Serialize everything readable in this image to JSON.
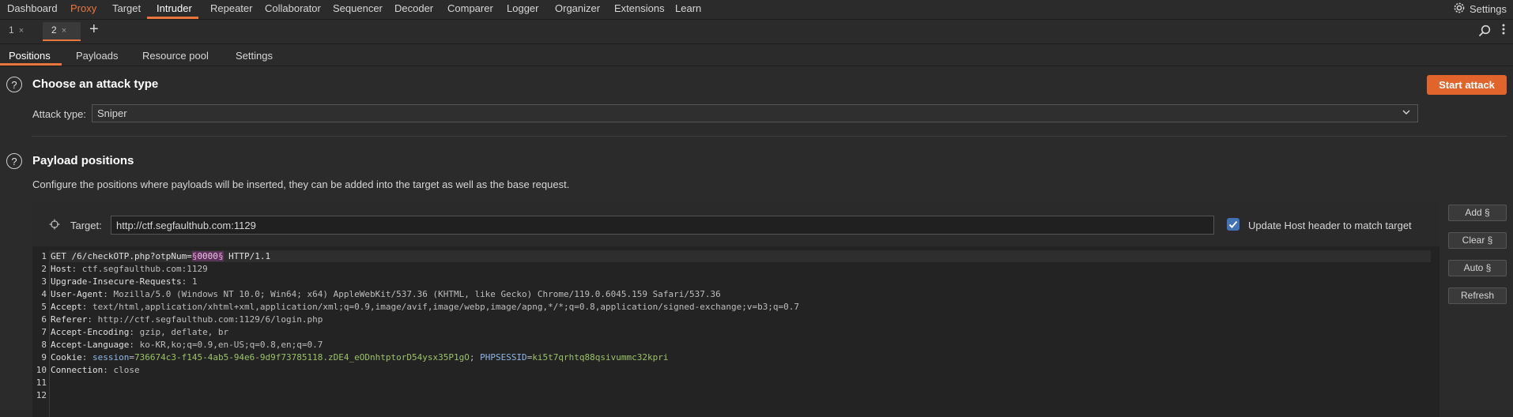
{
  "nav": {
    "items": [
      "Dashboard",
      "Proxy",
      "Target",
      "Intruder",
      "Repeater",
      "Collaborator",
      "Sequencer",
      "Decoder",
      "Comparer",
      "Logger",
      "Organizer",
      "Extensions",
      "Learn"
    ],
    "settings": "Settings"
  },
  "request_tabs": [
    {
      "label": "1",
      "close": "×"
    },
    {
      "label": "2",
      "close": "×"
    }
  ],
  "add_tab": "+",
  "sub_tabs": [
    "Positions",
    "Payloads",
    "Resource pool",
    "Settings"
  ],
  "attack": {
    "title": "Choose an attack type",
    "start_button": "Start attack",
    "type_label": "Attack type:",
    "type_value": "Sniper"
  },
  "payload": {
    "title": "Payload positions",
    "description": "Configure the positions where payloads will be inserted, they can be added into the target as well as the base request.",
    "target_label": "Target:",
    "target_value": "http://ctf.segfaulthub.com:1129",
    "update_host_label": "Update Host header to match target",
    "update_host_checked": true
  },
  "side_buttons": [
    "Add §",
    "Clear §",
    "Auto §",
    "Refresh"
  ],
  "request": {
    "line_numbers": [
      "1",
      "2",
      "3",
      "4",
      "5",
      "6",
      "7",
      "8",
      "9",
      "10",
      "11",
      "12"
    ],
    "l1_a": "GET /6/checkOTP.php?otpNum=",
    "l1_marker_open": "§",
    "l1_value": "0000",
    "l1_marker_close": "§",
    "l1_b": " HTTP/1.1",
    "l2_k": "Host",
    "l2_v": "ctf.segfaulthub.com:1129",
    "l3_k": "Upgrade-Insecure-Requests",
    "l3_v": "1",
    "l4_k": "User-Agent",
    "l4_v": "Mozilla/5.0 (Windows NT 10.0; Win64; x64) AppleWebKit/537.36 (KHTML, like Gecko) Chrome/119.0.6045.159 Safari/537.36",
    "l5_k": "Accept",
    "l5_v": "text/html,application/xhtml+xml,application/xml;q=0.9,image/avif,image/webp,image/apng,*/*;q=0.8,application/signed-exchange;v=b3;q=0.7",
    "l6_k": "Referer",
    "l6_v": "http://ctf.segfaulthub.com:1129/6/login.php",
    "l7_k": "Accept-Encoding",
    "l7_v": "gzip, deflate, br",
    "l8_k": "Accept-Language",
    "l8_v": "ko-KR,ko;q=0.9,en-US;q=0.8,en;q=0.7",
    "l9_k": "Cookie",
    "l9_c1_name": "session",
    "l9_c1_val": "736674c3-f145-4ab5-94e6-9d9f73785118.zDE4_eODnhtptorD54ysx35P1gO",
    "l9_c2_name": "PHPSESSID",
    "l9_c2_val": "ki5t7qrhtq88qsivummc32kpri",
    "l10_k": "Connection",
    "l10_v": "close"
  },
  "colors": {
    "accent": "#e9773d",
    "start_button": "#e0642b",
    "checkbox": "#3f72b7",
    "marker_bg": "#5a3358",
    "cookie_value": "#9bc26a"
  },
  "icons": [
    "gear-icon",
    "search-icon",
    "more-vertical-icon",
    "help-icon",
    "crosshair-icon",
    "chevron-down-icon",
    "checkmark-icon"
  ]
}
